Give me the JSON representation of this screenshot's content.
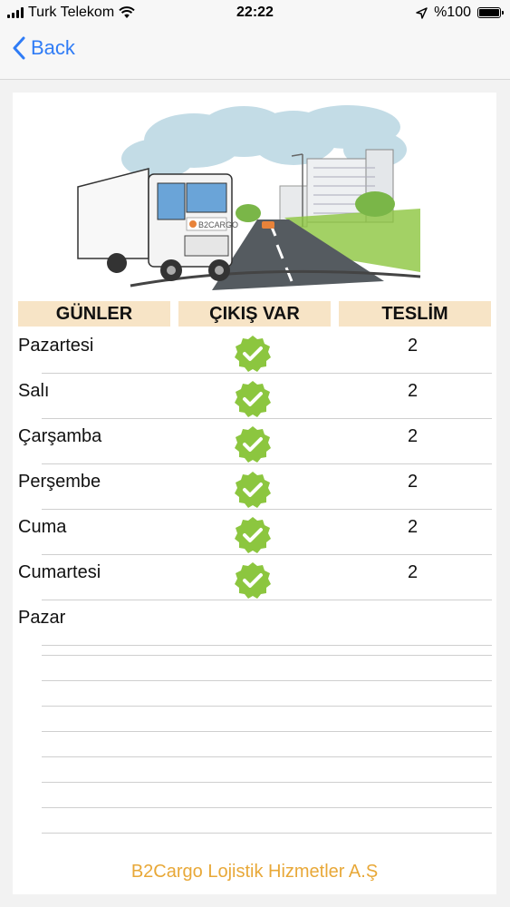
{
  "status_bar": {
    "carrier": "Turk Telekom",
    "time": "22:22",
    "battery": "%100",
    "icons": [
      "signal-icon",
      "wifi-icon",
      "location-arrow-icon",
      "battery-icon"
    ]
  },
  "nav": {
    "back_label": "Back"
  },
  "table": {
    "headers": [
      "GÜNLER",
      "ÇIKIŞ VAR",
      "TESLİM"
    ],
    "rows": [
      {
        "day": "Pazartesi",
        "departure": true,
        "delivery": "2"
      },
      {
        "day": "Salı",
        "departure": true,
        "delivery": "2"
      },
      {
        "day": "Çarşamba",
        "departure": true,
        "delivery": "2"
      },
      {
        "day": "Perşembe",
        "departure": true,
        "delivery": "2"
      },
      {
        "day": "Cuma",
        "departure": true,
        "delivery": "2"
      },
      {
        "day": "Cumartesi",
        "departure": true,
        "delivery": "2"
      },
      {
        "day": "Pazar",
        "departure": false,
        "delivery": ""
      }
    ]
  },
  "illustration": {
    "truck_brand": "B2CARGO"
  },
  "footer": {
    "company": "B2Cargo Lojistik Hizmetler A.Ş"
  },
  "colors": {
    "accent_blue": "#2f7cf6",
    "header_bg": "#f7e4c6",
    "check_green": "#8cc63f",
    "footer_orange": "#e8a838"
  }
}
